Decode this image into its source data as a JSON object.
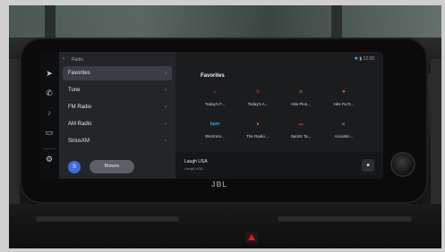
{
  "header": {
    "back_icon": "chevron-left-icon",
    "title": "Radio"
  },
  "status": {
    "bluetooth_icon": "bluetooth-icon",
    "signal_icon": "signal-icon",
    "time": "12:30"
  },
  "rail": [
    {
      "icon": "navigation-icon",
      "glyph": "➤"
    },
    {
      "icon": "phone-icon",
      "glyph": "✆"
    },
    {
      "icon": "music-icon",
      "glyph": "♪"
    },
    {
      "icon": "car-icon",
      "glyph": "▭"
    },
    {
      "icon": "settings-icon",
      "glyph": "⚙"
    }
  ],
  "menu": [
    {
      "label": "Favorites",
      "active": true
    },
    {
      "label": "Tune"
    },
    {
      "label": "FM Radio"
    },
    {
      "label": "AM Radio"
    },
    {
      "label": "SiriusXM"
    }
  ],
  "browse": {
    "avatar_letter": "S",
    "label": "Browse"
  },
  "favorites": {
    "title": "Favorites",
    "tiles": [
      {
        "label": "Today's F...",
        "logo": "♫",
        "color": "#e23a8f"
      },
      {
        "label": "Today's A...",
        "logo": "☆",
        "color": "#d9382f"
      },
      {
        "label": "Hits Plus...",
        "logo": "≈",
        "color": "#f2b318"
      },
      {
        "label": "Hits Fa R...",
        "logo": "✦",
        "color": "#f07a1a"
      },
      {
        "label": "Electroni...",
        "logo": "bpm",
        "color": "#29a8e0"
      },
      {
        "label": "The Radio ...",
        "logo": "●",
        "color": "#e8742a"
      },
      {
        "label": "Sports Ta...",
        "logo": "▬",
        "color": "#c8202a"
      },
      {
        "label": "Acoustic...",
        "logo": "♬",
        "color": "#cfd2d6"
      }
    ]
  },
  "now_playing": {
    "title": "Laugh USA",
    "subtitle": "Laugh USA",
    "stop_icon": "stop-icon"
  },
  "brand": "JBL"
}
